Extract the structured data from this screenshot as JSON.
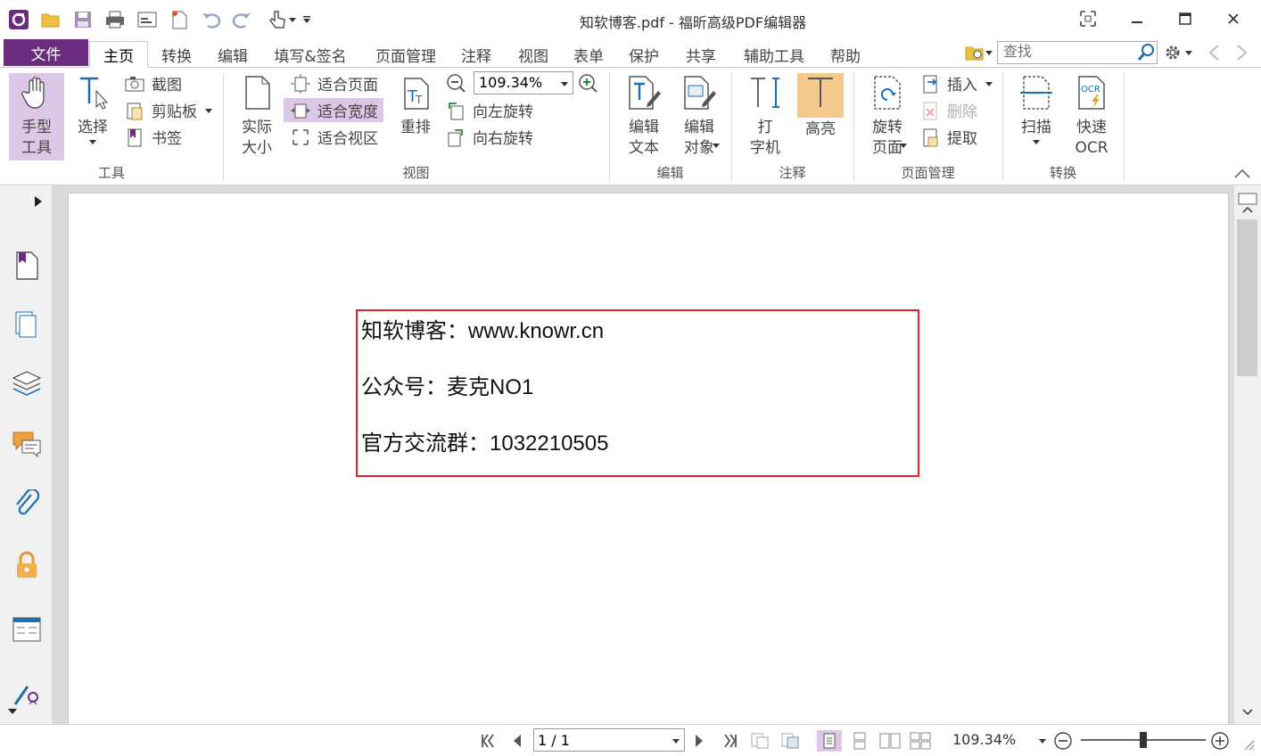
{
  "window": {
    "title": "知软博客.pdf - 福昕高级PDF编辑器"
  },
  "tabs": {
    "file": "文件",
    "items": [
      "主页",
      "转换",
      "编辑",
      "填写&签名",
      "页面管理",
      "注释",
      "视图",
      "表单",
      "保护",
      "共享",
      "辅助工具",
      "帮助"
    ],
    "active": "主页"
  },
  "search": {
    "placeholder": "查找"
  },
  "ribbon": {
    "tools_group": {
      "label": "工具",
      "hand_tool": "手型\n工具",
      "select": "选择",
      "screenshot": "截图",
      "clipboard": "剪贴板",
      "bookmark": "书签"
    },
    "view_group": {
      "label": "视图",
      "actual_size": "实际\n大小",
      "fit_page": "适合页面",
      "fit_width": "适合宽度",
      "fit_view": "适合视区",
      "reflow": "重排",
      "zoom_value": "109.34%",
      "rotate_left": "向左旋转",
      "rotate_right": "向右旋转"
    },
    "edit_group": {
      "label": "编辑",
      "edit_text": "编辑\n文本",
      "edit_object": "编辑\n对象"
    },
    "annot_group": {
      "label": "注释",
      "typewriter": "打\n字机",
      "highlight": "高亮"
    },
    "pages_group": {
      "label": "页面管理",
      "rotate_page": "旋转\n页面",
      "insert": "插入",
      "delete": "删除",
      "extract": "提取"
    },
    "convert_group": {
      "label": "转换",
      "scan": "扫描",
      "quick_ocr": "快速\nOCR"
    }
  },
  "document": {
    "lines": [
      "知软博客：www.knowr.cn",
      "公众号：麦克NO1",
      "官方交流群：1032210505"
    ]
  },
  "status": {
    "page_value": "1 / 1",
    "zoom": "109.34%"
  },
  "colors": {
    "accent": "#6b2c80",
    "selected": "#dcc8e6",
    "highlight": "#f3c98d",
    "box_border": "#e0232b"
  }
}
